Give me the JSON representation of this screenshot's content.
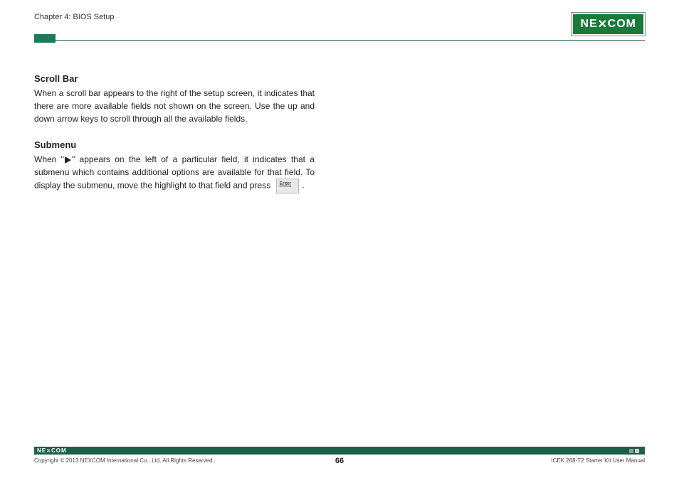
{
  "header": {
    "chapter_title": "Chapter 4: BIOS Setup",
    "logo_text_left": "NE",
    "logo_text_x": "X",
    "logo_text_right": "COM"
  },
  "content": {
    "section1": {
      "heading": "Scroll Bar",
      "text": "When a scroll bar appears to the right of the setup screen, it indicates that there are more available fields not shown on the screen. Use the up and down arrow keys to scroll through all the available fields."
    },
    "section2": {
      "heading": "Submenu",
      "text_part1": "When \"",
      "text_part2": "\" appears on the left of a particular field, it indicates that a submenu which contains additional options are available for that field. To display the submenu, move the highlight to that field and press",
      "enter_label": "Enter",
      "text_part3": "."
    }
  },
  "footer": {
    "logo_text": "NE COM",
    "copyright": "Copyright © 2013 NEXCOM International Co., Ltd. All Rights Reserved.",
    "page_number": "66",
    "manual_name": "ICEK 268-T2 Starter Kit User Manual"
  }
}
